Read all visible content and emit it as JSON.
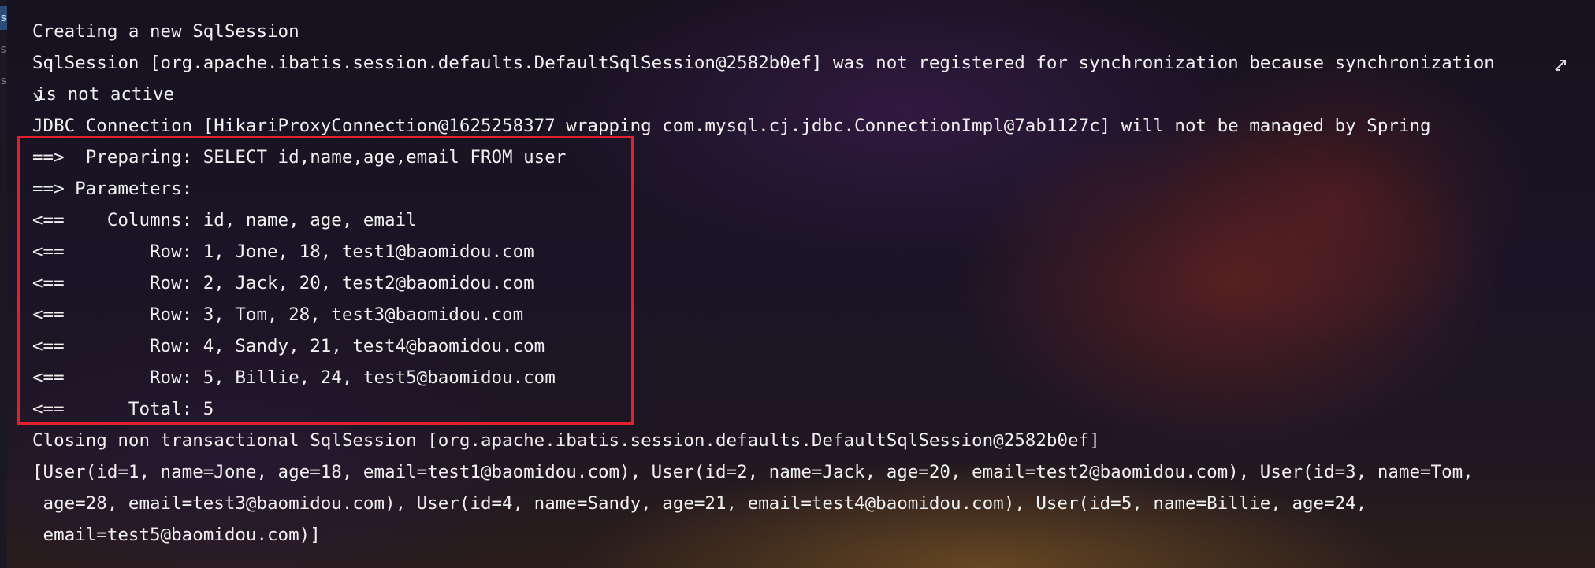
{
  "gutter": {
    "marks": [
      "s",
      "s",
      "s"
    ]
  },
  "console": {
    "lines": [
      "Creating a new SqlSession",
      "SqlSession [org.apache.ibatis.session.defaults.DefaultSqlSession@2582b0ef] was not registered for synchronization because synchronization",
      "is not active",
      "JDBC Connection [HikariProxyConnection@1625258377 wrapping com.mysql.cj.jdbc.ConnectionImpl@7ab1127c] will not be managed by Spring",
      "==>  Preparing: SELECT id,name,age,email FROM user",
      "==> Parameters: ",
      "<==    Columns: id, name, age, email",
      "<==        Row: 1, Jone, 18, test1@baomidou.com",
      "<==        Row: 2, Jack, 20, test2@baomidou.com",
      "<==        Row: 3, Tom, 28, test3@baomidou.com",
      "<==        Row: 4, Sandy, 21, test4@baomidou.com",
      "<==        Row: 5, Billie, 24, test5@baomidou.com",
      "<==      Total: 5",
      "Closing non transactional SqlSession [org.apache.ibatis.session.defaults.DefaultSqlSession@2582b0ef]",
      "[User(id=1, name=Jone, age=18, email=test1@baomidou.com), User(id=2, name=Jack, age=20, email=test2@baomidou.com), User(id=3, name=Tom,",
      " age=28, email=test3@baomidou.com), User(id=4, name=Sandy, age=21, email=test4@baomidou.com), User(id=5, name=Billie, age=24,",
      " email=test5@baomidou.com)]"
    ]
  },
  "colors": {
    "highlight_border": "#e0202a",
    "text": "#f0f0f0",
    "gutter_active": "#2c4d77"
  },
  "icons": {
    "wrap_end": "soft-wrap-arrow-icon",
    "wrap_start": "soft-wrap-continuation-icon"
  }
}
